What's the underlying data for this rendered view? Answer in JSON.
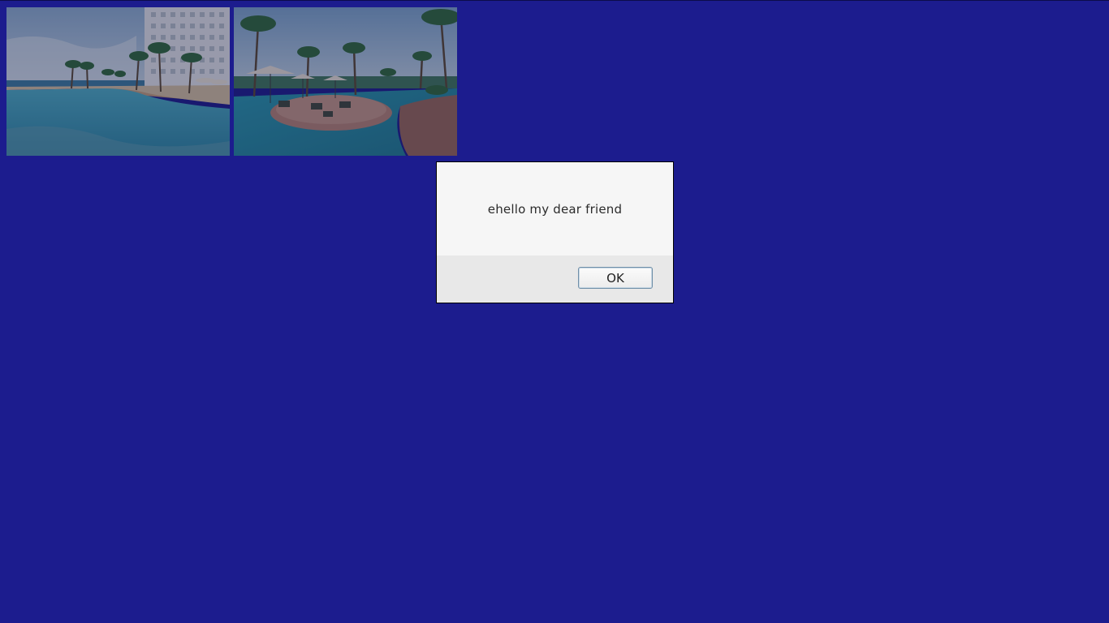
{
  "colors": {
    "page_background": "#1c1c8e",
    "dialog_background": "#f6f6f6",
    "dialog_footer": "#e8e8e8",
    "button_border": "#6f8fa8"
  },
  "photos": [
    {
      "name": "resort-pool-photo"
    },
    {
      "name": "resort-lagoon-cafe-photo"
    }
  ],
  "dialog": {
    "message": "ehello my dear friend",
    "ok_label": "OK"
  }
}
